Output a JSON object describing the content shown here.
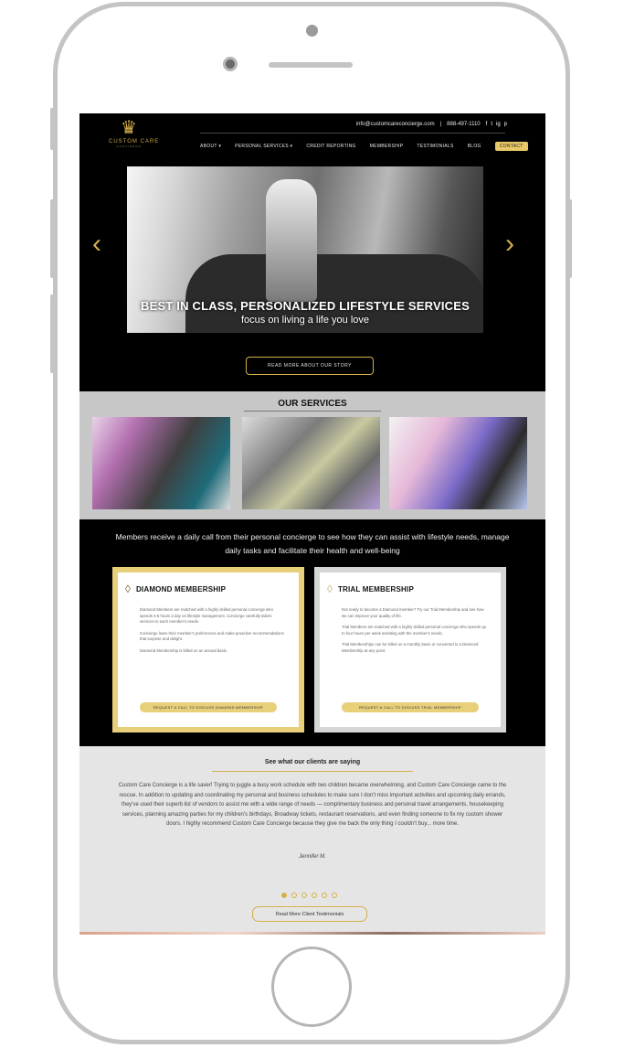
{
  "header": {
    "logo_text": "CUSTOM CARE",
    "logo_sub": "CONCIERGE",
    "email": "info@customcareconcierge.com",
    "separator": "|",
    "phone": "888-497-1110",
    "social_icons": [
      "f",
      "t",
      "ig",
      "p"
    ],
    "nav": [
      "ABOUT ▾",
      "PERSONAL SERVICES ▾",
      "CREDIT REPORTING",
      "MEMBERSHIP",
      "TESTIMONIALS",
      "BLOG",
      "CONTACT"
    ]
  },
  "hero": {
    "caption_1": "BEST IN CLASS, PERSONALIZED LIFESTYLE SERVICES",
    "caption_2": "focus on living a life you love",
    "prev_arrow": "‹",
    "next_arrow": "›",
    "story_button": "READ MORE ABOUT OUR STORY"
  },
  "services": {
    "title": "OUR SERVICES"
  },
  "membership": {
    "intro": "Members receive a daily call from their personal concierge to see how they can assist with lifestyle needs, manage daily tasks and facilitate their health and well-being",
    "diamond": {
      "title": "DIAMOND MEMBERSHIP",
      "p1": "Diamond Members are matched with a highly skilled personal concierge who spends 4-5 hours a day on lifestyle management. Concierge carefully tailors services to each member's needs.",
      "p2": "Concierge learn their member's preferences and make proactive recommendations that surprise and delight.",
      "p3": "Diamond Membership is billed on an annual basis.",
      "button": "REQUEST A CALL TO DISCUSS DIAMOND MEMBERSHIP"
    },
    "trial": {
      "title": "TRIAL MEMBERSHIP",
      "p1": "Not ready to become a Diamond member? Try our Trial Membership and see how we can improve your quality of life.",
      "p2": "Trial Members are matched with a highly skilled personal concierge who spends up to four hours per week assisting with the member's needs.",
      "p3": "Trial Memberships can be billed on a monthly basis or converted to a Diamond Membership at any point.",
      "button": "REQUEST A CALL TO DISCUSS TRIAL MEMBERSHIP"
    }
  },
  "testimonials": {
    "title": "See what our clients are saying",
    "body": "Custom Care Concierge is a life saver! Trying to juggle a busy work schedule with two children became overwhelming, and Custom Care Concierge came to the rescue. In addition to updating and coordinating my personal and business schedules to make sure I don't miss important activities and upcoming daily errands, they've used their superb list of vendors to assist me with a wide range of needs — complimentary business and personal travel arrangements, housekeeping services, planning amazing parties for my children's birthdays, Broadway tickets, restaurant reservations, and even finding someone to fix my custom shower doors. I highly recommend Custom Care Concierge because they give me back the only thing I couldn't buy... more time.",
    "author": "Jennifer M.",
    "button": "Read More Client Testimonials",
    "dots_total": 6,
    "dots_active": 0
  },
  "colors": {
    "gold": "#d4b04c",
    "gold_light": "#e8cf7a",
    "frame": "#c4c4c4",
    "screen_bg": "#000000",
    "services_bg": "#c7c7c7",
    "testimonials_bg": "#e5e5e5"
  }
}
